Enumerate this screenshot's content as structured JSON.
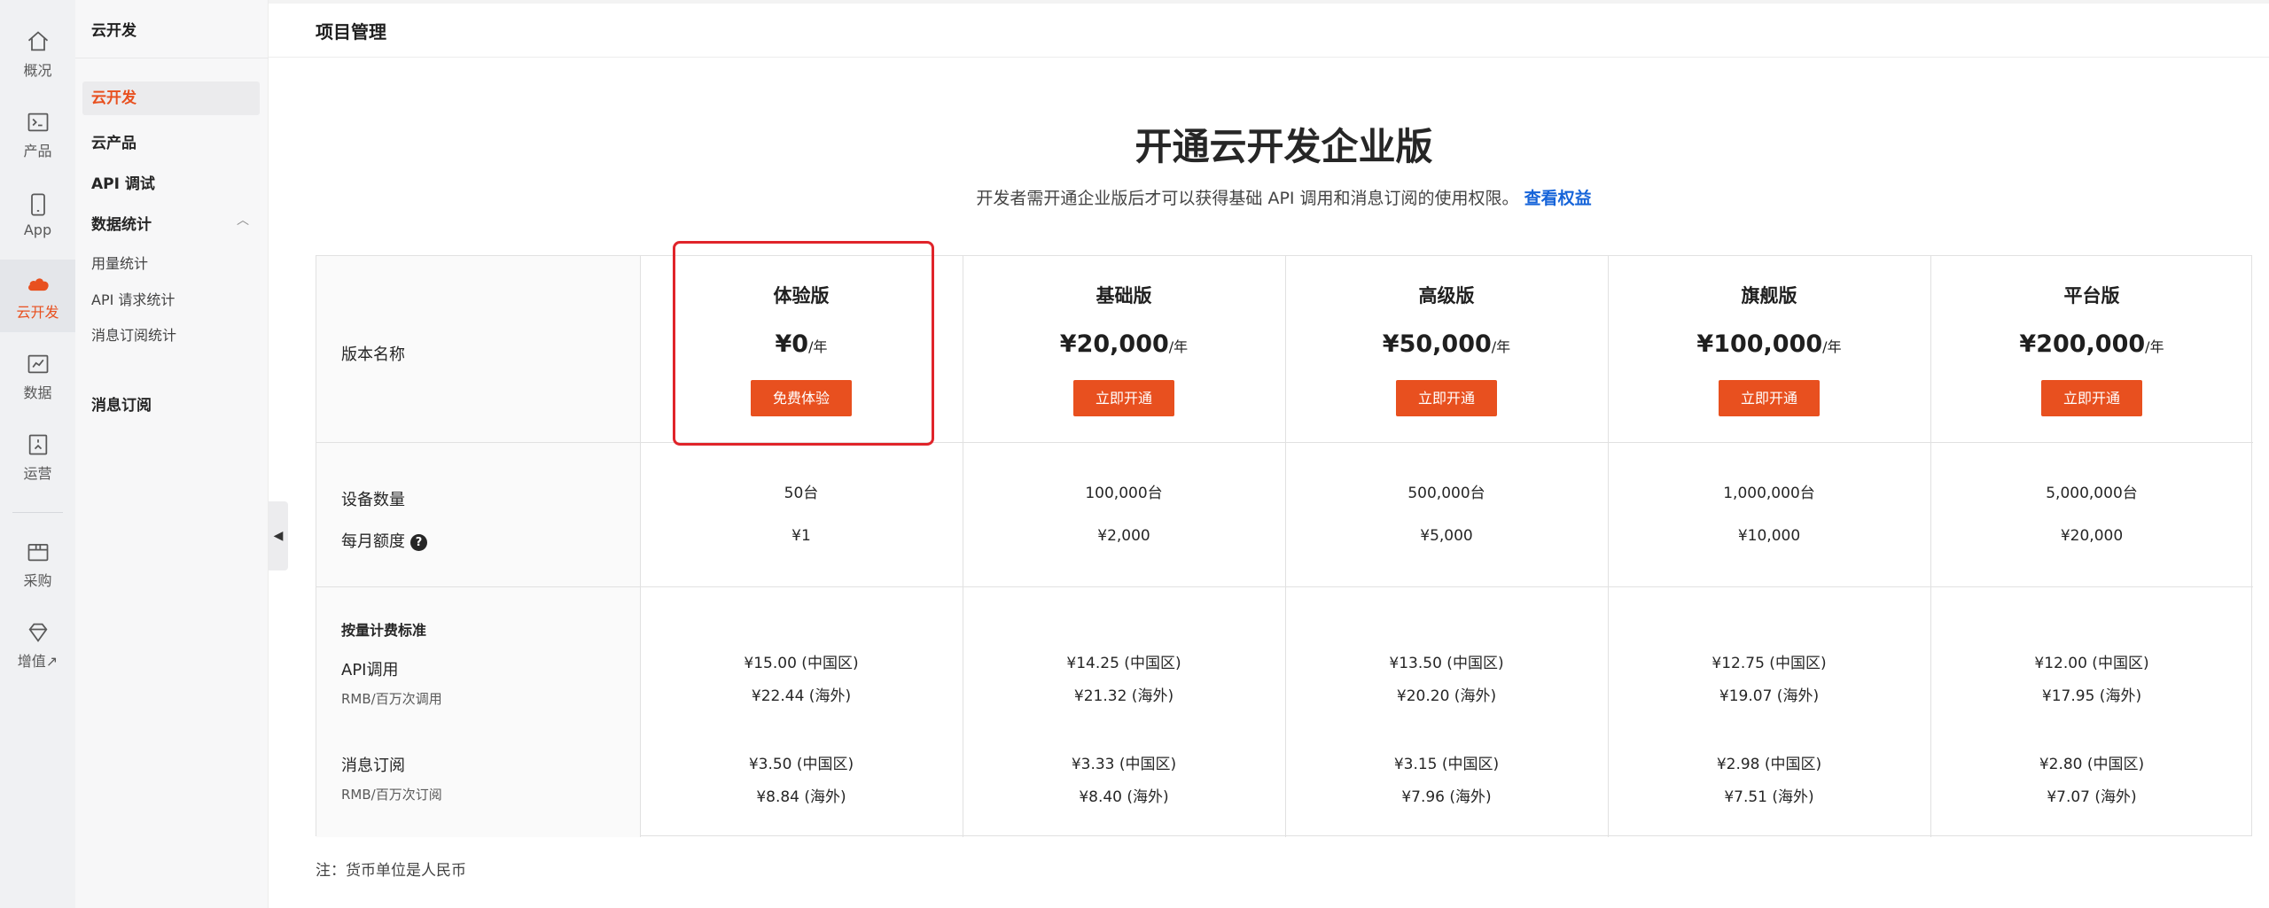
{
  "rail": {
    "items": [
      {
        "label": "概况",
        "icon": "home-icon"
      },
      {
        "label": "产品",
        "icon": "terminal-icon"
      },
      {
        "label": "App",
        "icon": "phone-icon"
      },
      {
        "label": "云开发",
        "icon": "cloud-icon"
      },
      {
        "label": "数据",
        "icon": "chart-icon"
      },
      {
        "label": "运营",
        "icon": "badge-icon"
      },
      {
        "label": "采购",
        "icon": "box-icon"
      },
      {
        "label": "增值↗",
        "icon": "diamond-icon"
      }
    ],
    "active_color": "#e8501f"
  },
  "submenu": {
    "title": "云开发",
    "items": [
      "云开发",
      "云产品",
      "API 调试",
      "数据统计",
      "消息订阅"
    ],
    "stats_children": [
      "用量统计",
      "API 请求统计",
      "消息订阅统计"
    ]
  },
  "page": {
    "title": "项目管理",
    "hero_title": "开通云开发企业版",
    "hero_sub": "开发者需开通企业版后才可以获得基础 API 调用和消息订阅的使用权限。",
    "hero_link": "查看权益",
    "note": "注：货币单位是人民币"
  },
  "table": {
    "labels": {
      "version": "版本名称",
      "devices": "设备数量",
      "monthly": "每月额度",
      "pricing_title": "按量计费标准",
      "api": "API调用",
      "api_unit": "RMB/百万次调用",
      "msg": "消息订阅",
      "msg_unit": "RMB/百万次订阅"
    },
    "unit_year": "/年",
    "plans": [
      {
        "name": "体验版",
        "price": "¥0",
        "button": "免费体验",
        "devices": "50台",
        "quota": "¥1",
        "api_cn": "¥15.00 (中国区)",
        "api_os": "¥22.44 (海外)",
        "msg_cn": "¥3.50 (中国区)",
        "msg_os": "¥8.84 (海外)"
      },
      {
        "name": "基础版",
        "price": "¥20,000",
        "button": "立即开通",
        "devices": "100,000台",
        "quota": "¥2,000",
        "api_cn": "¥14.25 (中国区)",
        "api_os": "¥21.32 (海外)",
        "msg_cn": "¥3.33 (中国区)",
        "msg_os": "¥8.40 (海外)"
      },
      {
        "name": "高级版",
        "price": "¥50,000",
        "button": "立即开通",
        "devices": "500,000台",
        "quota": "¥5,000",
        "api_cn": "¥13.50 (中国区)",
        "api_os": "¥20.20 (海外)",
        "msg_cn": "¥3.15 (中国区)",
        "msg_os": "¥7.96 (海外)"
      },
      {
        "name": "旗舰版",
        "price": "¥100,000",
        "button": "立即开通",
        "devices": "1,000,000台",
        "quota": "¥10,000",
        "api_cn": "¥12.75 (中国区)",
        "api_os": "¥19.07 (海外)",
        "msg_cn": "¥2.98 (中国区)",
        "msg_os": "¥7.51 (海外)"
      },
      {
        "name": "平台版",
        "price": "¥200,000",
        "button": "立即开通",
        "devices": "5,000,000台",
        "quota": "¥20,000",
        "api_cn": "¥12.00 (中国区)",
        "api_os": "¥17.95 (海外)",
        "msg_cn": "¥2.80 (中国区)",
        "msg_os": "¥7.07 (海外)"
      }
    ]
  }
}
